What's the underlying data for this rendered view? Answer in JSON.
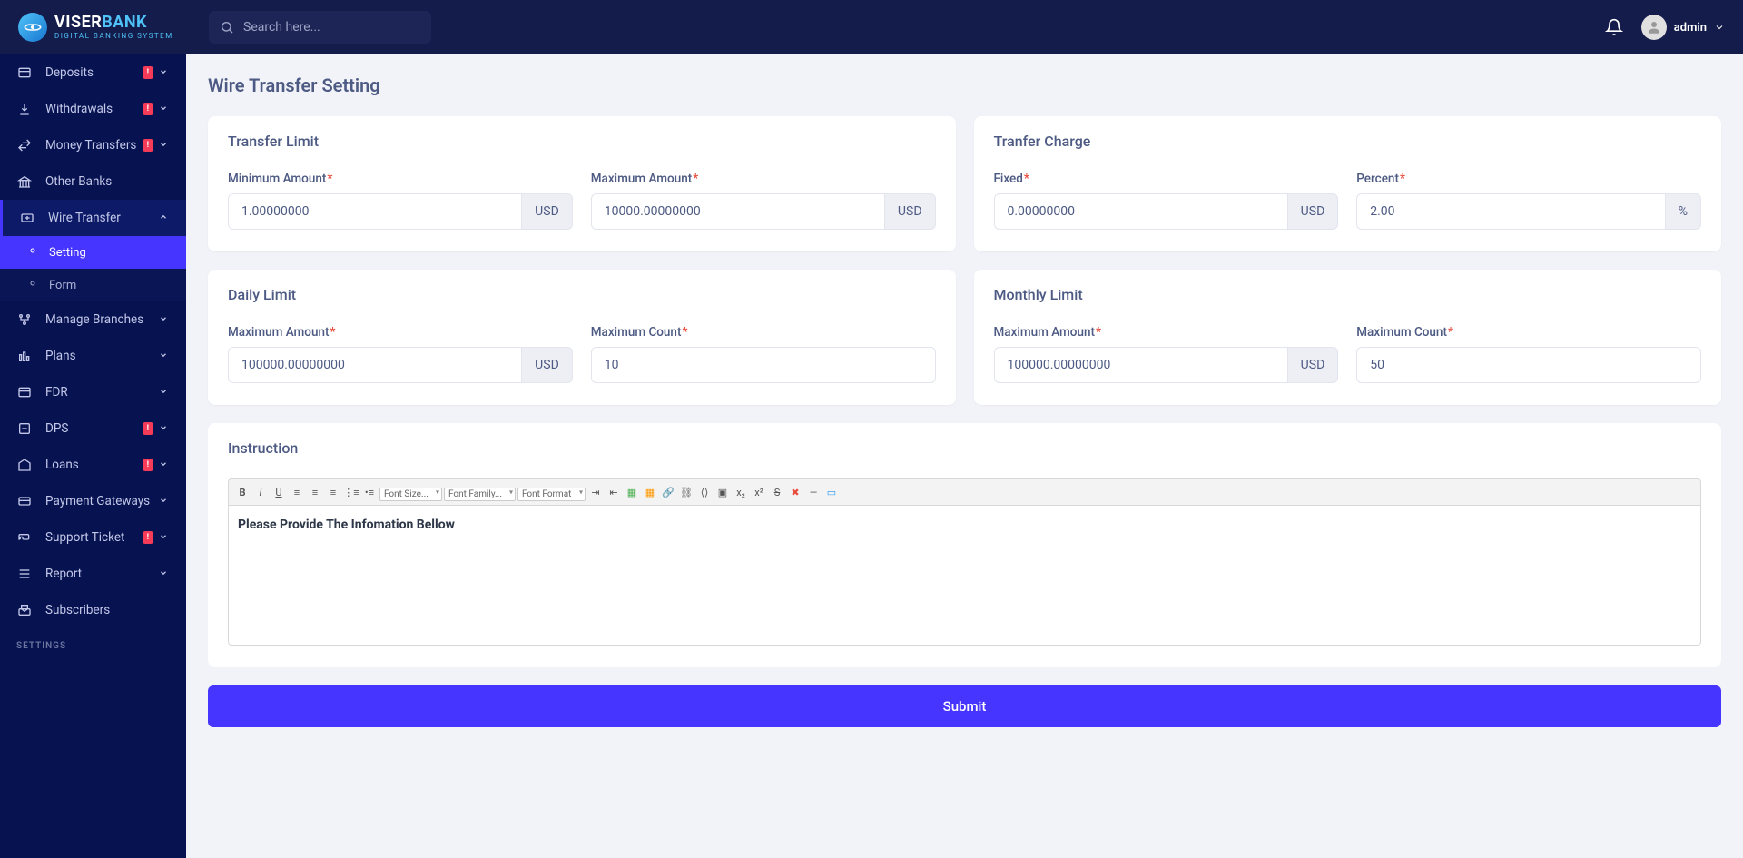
{
  "header": {
    "logo_main_viser": "VISER",
    "logo_main_bank": "BANK",
    "logo_sub": "DIGITAL BANKING SYSTEM",
    "search_placeholder": "Search here...",
    "username": "admin"
  },
  "sidebar": {
    "items": [
      {
        "label": "Deposits",
        "badge": "!",
        "chevron": true
      },
      {
        "label": "Withdrawals",
        "badge": "!",
        "chevron": true
      },
      {
        "label": "Money Transfers",
        "badge": "!",
        "chevron": true
      },
      {
        "label": "Other Banks"
      },
      {
        "label": "Wire Transfer",
        "chevron": true,
        "active": true
      },
      {
        "label": "Manage Branches",
        "chevron": true
      },
      {
        "label": "Plans",
        "chevron": true
      },
      {
        "label": "FDR",
        "chevron": true
      },
      {
        "label": "DPS",
        "badge": "!",
        "chevron": true
      },
      {
        "label": "Loans",
        "badge": "!",
        "chevron": true
      },
      {
        "label": "Payment Gateways",
        "chevron": true
      },
      {
        "label": "Support Ticket",
        "badge": "!",
        "chevron": true
      },
      {
        "label": "Report",
        "chevron": true
      },
      {
        "label": "Subscribers"
      }
    ],
    "sub_setting": "Setting",
    "sub_form": "Form",
    "settings_label": "SETTINGS"
  },
  "page": {
    "title": "Wire Transfer Setting",
    "transfer_limit": {
      "title": "Transfer Limit",
      "min_label": "Minimum Amount",
      "min_value": "1.00000000",
      "max_label": "Maximum Amount",
      "max_value": "10000.00000000",
      "currency": "USD"
    },
    "transfer_charge": {
      "title": "Tranfer Charge",
      "fixed_label": "Fixed",
      "fixed_value": "0.00000000",
      "percent_label": "Percent",
      "percent_value": "2.00",
      "currency": "USD",
      "percent_symbol": "%"
    },
    "daily_limit": {
      "title": "Daily Limit",
      "max_amount_label": "Maximum Amount",
      "max_amount_value": "100000.00000000",
      "max_count_label": "Maximum Count",
      "max_count_value": "10",
      "currency": "USD"
    },
    "monthly_limit": {
      "title": "Monthly Limit",
      "max_amount_label": "Maximum Amount",
      "max_amount_value": "100000.00000000",
      "max_count_label": "Maximum Count",
      "max_count_value": "50",
      "currency": "USD"
    },
    "instruction": {
      "title": "Instruction",
      "font_size": "Font Size...",
      "font_family": "Font Family...",
      "font_format": "Font Format",
      "content": "Please Provide The Infomation Bellow"
    },
    "submit_label": "Submit"
  }
}
